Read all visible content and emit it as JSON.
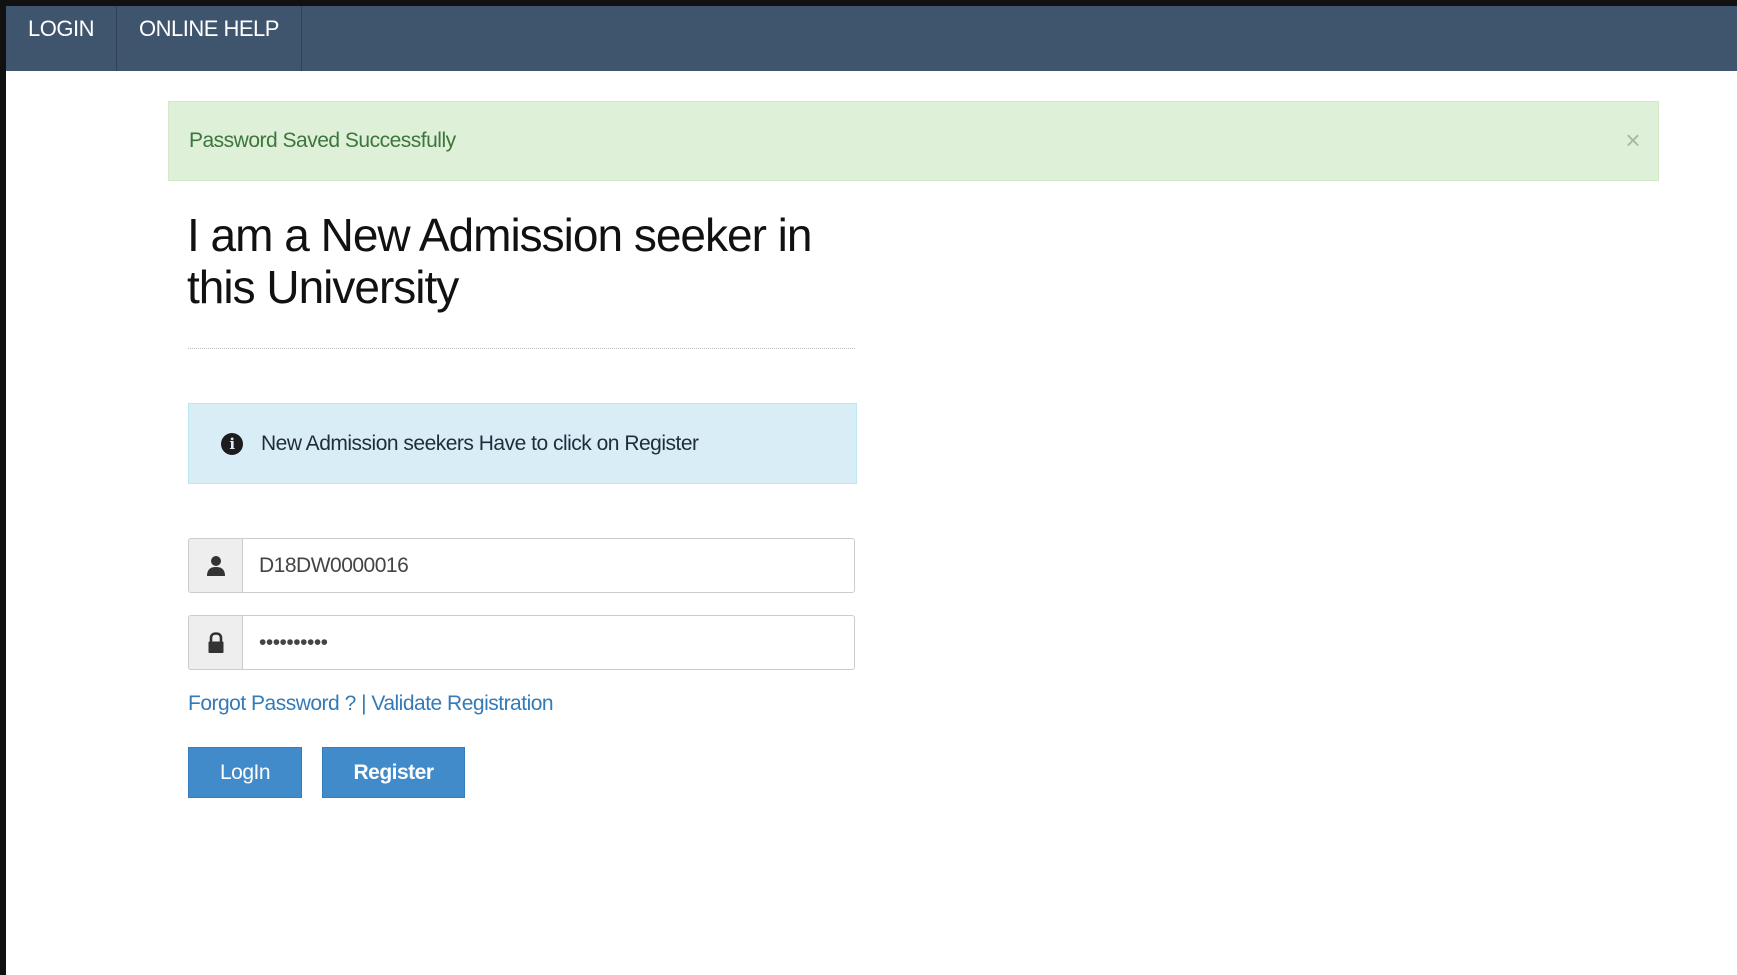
{
  "navbar": {
    "items": [
      {
        "label": "LOGIN"
      },
      {
        "label": "ONLINE HELP"
      }
    ],
    "background": "#3f556d"
  },
  "alerts": {
    "success_message": "Password Saved Successfully",
    "close_symbol": "×",
    "info_message": "New Admission seekers Have to click on Register"
  },
  "heading": {
    "title": "I am a New Admission seeker in this University"
  },
  "form": {
    "username_value": "D18DW0000016",
    "password_value": "••••••••••",
    "username_icon": "user-icon",
    "password_icon": "lock-icon"
  },
  "links": {
    "forgot_password": "Forgot Password ?",
    "separator": " | ",
    "validate_registration": "Validate Registration"
  },
  "buttons": {
    "login_label": "LogIn",
    "register_label": "Register"
  },
  "colors": {
    "success_bg": "#dff0d8",
    "info_bg": "#d9edf7",
    "primary": "#428bca",
    "link": "#337ab7"
  }
}
